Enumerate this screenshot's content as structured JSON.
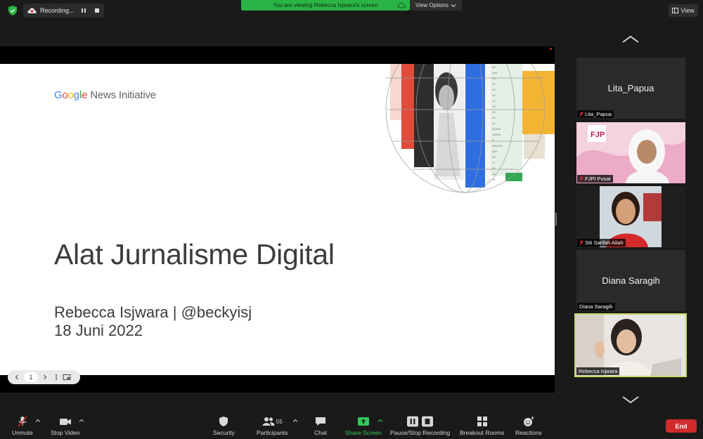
{
  "topbar": {
    "recording_label": "Recording...",
    "viewing_banner": "You are viewing Rebecca Isjwara's screen",
    "view_options": "View Options",
    "view_label": "View"
  },
  "slide": {
    "brand_google": [
      "G",
      "o",
      "o",
      "g",
      "l",
      "e"
    ],
    "brand_rest": " News Initiative",
    "title": "Alat Jurnalisme Digital",
    "author": "Rebecca Isjwara | @beckyisj",
    "date": "18 Juni 2022",
    "page": "1"
  },
  "gallery": [
    {
      "name": "Lita_Papua",
      "center": "Lita_Papua",
      "muted": true,
      "video": false
    },
    {
      "name": "FJPI Pusat",
      "muted": true,
      "video": true
    },
    {
      "name": "Siti Sarifah Aliah",
      "muted": true,
      "video": true
    },
    {
      "name": "Diana Saragih",
      "center": "Diana Saragih",
      "muted": false,
      "video": false
    },
    {
      "name": "Rebecca Isjwara",
      "muted": false,
      "video": true,
      "active": true
    }
  ],
  "toolbar": {
    "unmute": "Unmute",
    "stop_video": "Stop Video",
    "security": "Security",
    "participants": "Participants",
    "participants_count": "55",
    "chat": "Chat",
    "share_screen": "Share Screen",
    "pause_recording": "Pause/Stop Recording",
    "breakout_rooms": "Breakout Rooms",
    "reactions": "Reactions",
    "end": "End"
  },
  "colors": {
    "zoom_green": "#2bb446",
    "end_red": "#d22b2b",
    "active_speaker": "#c5d86d"
  }
}
